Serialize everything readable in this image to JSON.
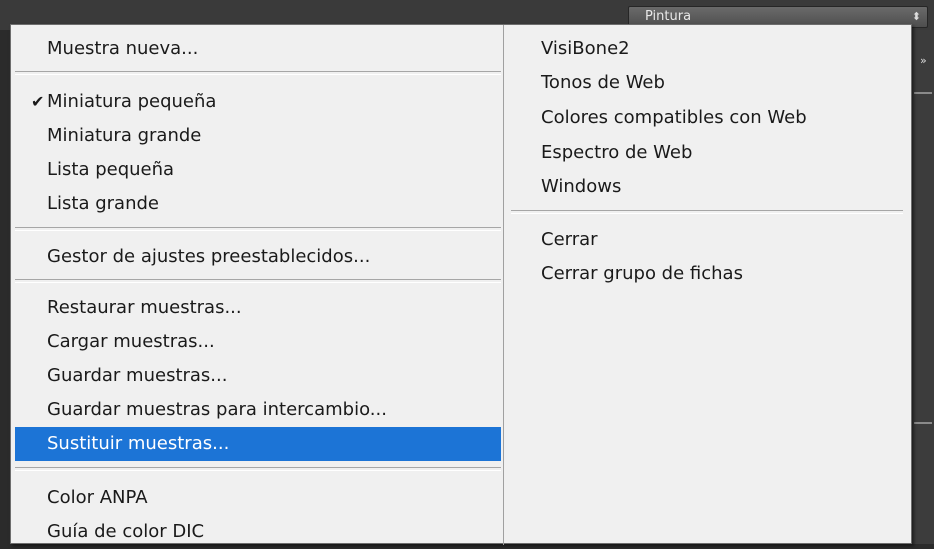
{
  "workspace": {
    "label": "Pintura"
  },
  "menu": {
    "left": {
      "new_swatch": "Muestra nueva...",
      "check_mark": "✔",
      "small_thumbnail": "Miniatura pequeña",
      "large_thumbnail": "Miniatura grande",
      "small_list": "Lista pequeña",
      "large_list": "Lista grande",
      "preset_manager": "Gestor de ajustes preestablecidos...",
      "restore": "Restaurar muestras...",
      "load": "Cargar muestras...",
      "save": "Guardar muestras...",
      "save_exchange": "Guardar muestras para intercambio...",
      "replace": "Sustituir muestras...",
      "anpa": "Color ANPA",
      "dic": "Guía de color DIC"
    },
    "right": {
      "visibone2": "VisiBone2",
      "web_hues": "Tonos de Web",
      "web_safe": "Colores compatibles con Web",
      "web_spectrum": "Espectro de Web",
      "windows": "Windows",
      "close": "Cerrar",
      "close_group": "Cerrar grupo de fichas"
    }
  },
  "colors": {
    "highlight": "#1c74d6",
    "menu_bg": "#f0f0f0"
  }
}
